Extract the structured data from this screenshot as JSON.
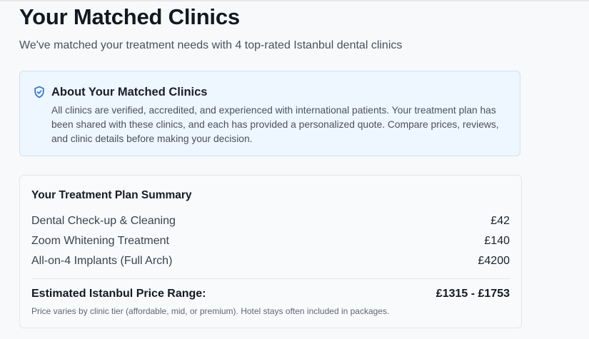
{
  "header": {
    "title": "Your Matched Clinics",
    "subtitle": "We've matched your treatment needs with 4 top-rated Istanbul dental clinics"
  },
  "info_card": {
    "icon": "shield-check-icon",
    "title": "About Your Matched Clinics",
    "text": "All clinics are verified, accredited, and experienced with international patients. Your treatment plan has been shared with these clinics, and each has provided a personalized quote. Compare prices, reviews, and clinic details before making your decision."
  },
  "summary": {
    "title": "Your Treatment Plan Summary",
    "items": [
      {
        "name": "Dental Check-up & Cleaning",
        "price": "£42"
      },
      {
        "name": "Zoom Whitening Treatment",
        "price": "£140"
      },
      {
        "name": "All-on-4 Implants (Full Arch)",
        "price": "£4200"
      }
    ],
    "estimate_label": "Estimated Istanbul Price Range:",
    "estimate_value": "£1315 - £1753",
    "note": "Price varies by clinic tier (affordable, mid, or premium). Hotel stays often included in packages."
  },
  "colors": {
    "accent": "#2f6fd6",
    "info_bg": "#eef6ff",
    "info_border": "#cfe1f6"
  }
}
